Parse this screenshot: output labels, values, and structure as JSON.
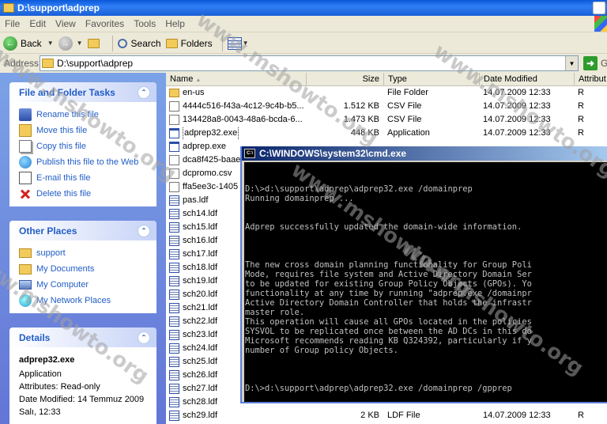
{
  "window": {
    "title": "D:\\support\\adprep"
  },
  "menu": [
    "File",
    "Edit",
    "View",
    "Favorites",
    "Tools",
    "Help"
  ],
  "toolbar": {
    "back_label": "Back",
    "search_label": "Search",
    "folders_label": "Folders"
  },
  "address": {
    "label": "Address",
    "value": "D:\\support\\adprep",
    "go_label": "G"
  },
  "file_tasks": {
    "title": "File and Folder Tasks",
    "items": [
      {
        "label": "Rename this file",
        "icon": "rename-icon"
      },
      {
        "label": "Move this file",
        "icon": "move-icon"
      },
      {
        "label": "Copy this file",
        "icon": "copy-icon"
      },
      {
        "label": "Publish this file to the Web",
        "icon": "web-icon"
      },
      {
        "label": "E-mail this file",
        "icon": "email-icon"
      },
      {
        "label": "Delete this file",
        "icon": "delete-icon"
      }
    ]
  },
  "other_places": {
    "title": "Other Places",
    "items": [
      {
        "label": "support",
        "icon": "folder-icon"
      },
      {
        "label": "My Documents",
        "icon": "my-documents-icon"
      },
      {
        "label": "My Computer",
        "icon": "my-computer-icon"
      },
      {
        "label": "My Network Places",
        "icon": "network-icon"
      }
    ]
  },
  "details": {
    "title": "Details",
    "filename": "adprep32.exe",
    "type": "Application",
    "attributes": "Attributes: Read-only",
    "date_modified": "Date Modified: 14 Temmuz 2009",
    "date_time": "Salı, 12:33"
  },
  "columns": {
    "name": "Name",
    "size": "Size",
    "type": "Type",
    "date": "Date Modified",
    "attr": "Attribut"
  },
  "files": [
    {
      "name": "en-us",
      "size": "",
      "type": "File Folder",
      "date": "14.07.2009 12:33",
      "attr": "R",
      "icon": "folder"
    },
    {
      "name": "4444c516-f43a-4c12-9c4b-b5...",
      "size": "1.512 KB",
      "type": "CSV File",
      "date": "14.07.2009 12:33",
      "attr": "R",
      "icon": "csv"
    },
    {
      "name": "134428a8-0043-48a6-bcda-6...",
      "size": "1.473 KB",
      "type": "CSV File",
      "date": "14.07.2009 12:33",
      "attr": "R",
      "icon": "csv"
    },
    {
      "name": "adprep32.exe",
      "size": "448 KB",
      "type": "Application",
      "date": "14.07.2009 12:33",
      "attr": "R",
      "icon": "exe"
    },
    {
      "name": "adprep.exe",
      "size": "",
      "type": "",
      "date": "",
      "attr": "",
      "icon": "exe"
    },
    {
      "name": "dca8f425-baae",
      "size": "",
      "type": "",
      "date": "",
      "attr": "",
      "icon": "csv"
    },
    {
      "name": "dcpromo.csv",
      "size": "",
      "type": "",
      "date": "",
      "attr": "",
      "icon": "csv"
    },
    {
      "name": "ffa5ee3c-1405",
      "size": "",
      "type": "",
      "date": "",
      "attr": "",
      "icon": "csv"
    },
    {
      "name": "pas.ldf",
      "size": "",
      "type": "",
      "date": "",
      "attr": "",
      "icon": "ldf"
    },
    {
      "name": "sch14.ldf",
      "size": "",
      "type": "",
      "date": "",
      "attr": "",
      "icon": "ldf"
    },
    {
      "name": "sch15.ldf",
      "size": "",
      "type": "",
      "date": "",
      "attr": "",
      "icon": "ldf"
    },
    {
      "name": "sch16.ldf",
      "size": "",
      "type": "",
      "date": "",
      "attr": "",
      "icon": "ldf"
    },
    {
      "name": "sch17.ldf",
      "size": "",
      "type": "",
      "date": "",
      "attr": "",
      "icon": "ldf"
    },
    {
      "name": "sch18.ldf",
      "size": "",
      "type": "",
      "date": "",
      "attr": "",
      "icon": "ldf"
    },
    {
      "name": "sch19.ldf",
      "size": "",
      "type": "",
      "date": "",
      "attr": "",
      "icon": "ldf"
    },
    {
      "name": "sch20.ldf",
      "size": "",
      "type": "",
      "date": "",
      "attr": "",
      "icon": "ldf"
    },
    {
      "name": "sch21.ldf",
      "size": "",
      "type": "",
      "date": "",
      "attr": "",
      "icon": "ldf"
    },
    {
      "name": "sch22.ldf",
      "size": "",
      "type": "",
      "date": "",
      "attr": "",
      "icon": "ldf"
    },
    {
      "name": "sch23.ldf",
      "size": "",
      "type": "",
      "date": "",
      "attr": "",
      "icon": "ldf"
    },
    {
      "name": "sch24.ldf",
      "size": "",
      "type": "",
      "date": "",
      "attr": "",
      "icon": "ldf"
    },
    {
      "name": "sch25.ldf",
      "size": "",
      "type": "",
      "date": "",
      "attr": "",
      "icon": "ldf"
    },
    {
      "name": "sch26.ldf",
      "size": "",
      "type": "",
      "date": "",
      "attr": "",
      "icon": "ldf"
    },
    {
      "name": "sch27.ldf",
      "size": "",
      "type": "",
      "date": "",
      "attr": "",
      "icon": "ldf"
    },
    {
      "name": "sch28.ldf",
      "size": "",
      "type": "",
      "date": "",
      "attr": "",
      "icon": "ldf"
    },
    {
      "name": "sch29.ldf",
      "size": "2 KB",
      "type": "LDF File",
      "date": "14.07.2009 12:33",
      "attr": "R",
      "icon": "ldf"
    }
  ],
  "cmd": {
    "title": "C:\\WINDOWS\\system32\\cmd.exe",
    "lines": [
      "",
      "",
      "D:\\>d:\\support\\adprep\\adprep32.exe /domainprep",
      "Running domainprep ...",
      "",
      "",
      "Adprep successfully updated the domain-wide information.",
      "",
      "",
      "",
      "The new cross domain planning functionality for Group Poli",
      "Mode, requires file system and Active Directory Domain Ser",
      "to be updated for existing Group Policy Objects (GPOs). Yo",
      "functionality at any time by running \"adprep.exe /domainpr",
      "Active Directory Domain Controller that holds the infrastr",
      "master role.",
      "This operation will cause all GPOs located in the policies",
      "SYSVOL to be replicated once between the AD DCs in this do",
      "Microsoft recommends reading KB Q324392, particularly if y",
      "number of Group policy Objects.",
      "",
      "",
      "",
      "D:\\>d:\\support\\adprep\\adprep32.exe /domainprep /gpprep"
    ]
  },
  "watermark": "www.mshowto.org"
}
